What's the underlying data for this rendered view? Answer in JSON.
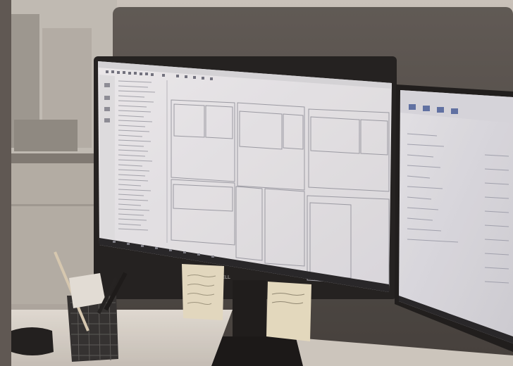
{
  "scene": {
    "description_free": true,
    "monitor_brand": "DELL",
    "note_left": "",
    "note_right": "",
    "colors": {
      "wall": "#b9b4ae",
      "partition": "#4a4644",
      "screen_bg": "#e9e9ee",
      "desk": "#d8d4cf",
      "sticky": "#e6dcc3",
      "window_glass": "#c9c6c2"
    }
  }
}
